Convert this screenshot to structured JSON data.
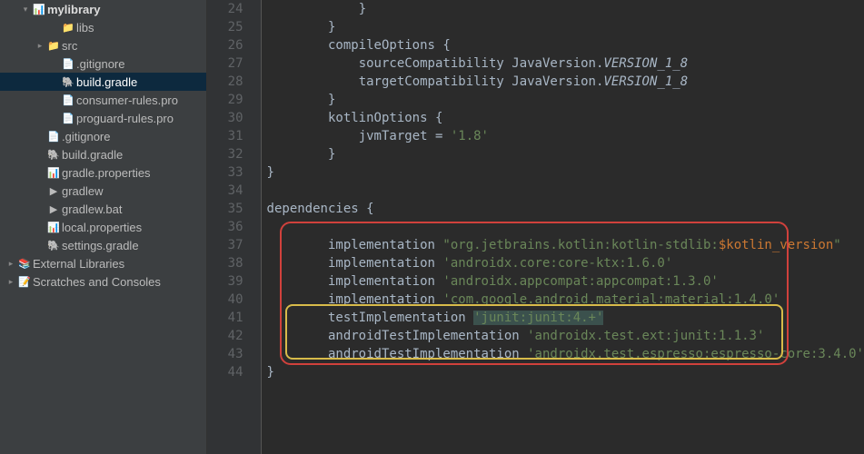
{
  "tree": {
    "root": "mylibrary",
    "items": [
      {
        "label": "libs",
        "kind": "folder"
      },
      {
        "label": "src",
        "kind": "folder-expandable"
      },
      {
        "label": ".gitignore",
        "kind": "file"
      },
      {
        "label": "build.gradle",
        "kind": "gradle",
        "selected": true
      },
      {
        "label": "consumer-rules.pro",
        "kind": "file"
      },
      {
        "label": "proguard-rules.pro",
        "kind": "file"
      }
    ],
    "rootFiles": [
      {
        "label": ".gitignore",
        "kind": "file"
      },
      {
        "label": "build.gradle",
        "kind": "gradle"
      },
      {
        "label": "gradle.properties",
        "kind": "props"
      },
      {
        "label": "gradlew",
        "kind": "script"
      },
      {
        "label": "gradlew.bat",
        "kind": "script"
      },
      {
        "label": "local.properties",
        "kind": "props"
      },
      {
        "label": "settings.gradle",
        "kind": "gradle"
      }
    ],
    "external": "External Libraries",
    "scratches": "Scratches and Consoles"
  },
  "code": {
    "startLine": 24,
    "lines": [
      {
        "n": 24,
        "indent": 3,
        "tokens": [
          [
            "plain",
            "}"
          ]
        ]
      },
      {
        "n": 25,
        "indent": 2,
        "tokens": [
          [
            "plain",
            "}"
          ]
        ]
      },
      {
        "n": 26,
        "indent": 2,
        "tokens": [
          [
            "plain",
            "compileOptions {"
          ]
        ]
      },
      {
        "n": 27,
        "indent": 3,
        "tokens": [
          [
            "plain",
            "sourceCompatibility JavaVersion."
          ],
          [
            "emph",
            "VERSION_1_8"
          ]
        ]
      },
      {
        "n": 28,
        "indent": 3,
        "tokens": [
          [
            "plain",
            "targetCompatibility JavaVersion."
          ],
          [
            "emph",
            "VERSION_1_8"
          ]
        ]
      },
      {
        "n": 29,
        "indent": 2,
        "tokens": [
          [
            "plain",
            "}"
          ]
        ]
      },
      {
        "n": 30,
        "indent": 2,
        "tokens": [
          [
            "plain",
            "kotlinOptions {"
          ]
        ]
      },
      {
        "n": 31,
        "indent": 3,
        "tokens": [
          [
            "plain",
            "jvmTarget = "
          ],
          [
            "str",
            "'1.8'"
          ]
        ]
      },
      {
        "n": 32,
        "indent": 2,
        "tokens": [
          [
            "plain",
            "}"
          ]
        ]
      },
      {
        "n": 33,
        "indent": 0,
        "tokens": [
          [
            "plain",
            "}"
          ]
        ]
      },
      {
        "n": 34,
        "indent": 0,
        "tokens": [
          [
            "plain",
            ""
          ]
        ]
      },
      {
        "n": 35,
        "indent": 0,
        "tokens": [
          [
            "plain",
            "dependencies {"
          ]
        ]
      },
      {
        "n": 36,
        "indent": 0,
        "tokens": [
          [
            "plain",
            ""
          ]
        ]
      },
      {
        "n": 37,
        "indent": 2,
        "tokens": [
          [
            "plain",
            "implementation "
          ],
          [
            "str",
            "\"org.jetbrains.kotlin:kotlin-stdlib:"
          ],
          [
            "varref",
            "$kotlin_version"
          ],
          [
            "str",
            "\""
          ]
        ]
      },
      {
        "n": 38,
        "indent": 2,
        "tokens": [
          [
            "plain",
            "implementation "
          ],
          [
            "str",
            "'androidx.core:core-ktx:1.6.0'"
          ]
        ]
      },
      {
        "n": 39,
        "indent": 2,
        "tokens": [
          [
            "plain",
            "implementation "
          ],
          [
            "str",
            "'androidx.appcompat:appcompat:1.3.0'"
          ]
        ]
      },
      {
        "n": 40,
        "indent": 2,
        "tokens": [
          [
            "plain",
            "implementation "
          ],
          [
            "str",
            "'com.google.android.material:material:1.4.0'"
          ]
        ]
      },
      {
        "n": 41,
        "indent": 2,
        "tokens": [
          [
            "plain",
            "testImplementation "
          ],
          [
            "str str-bg",
            "'junit:junit:4.+'"
          ]
        ]
      },
      {
        "n": 42,
        "indent": 2,
        "tokens": [
          [
            "plain",
            "androidTestImplementation "
          ],
          [
            "str",
            "'androidx.test.ext:junit:1.1.3'"
          ]
        ]
      },
      {
        "n": 43,
        "indent": 2,
        "tokens": [
          [
            "plain",
            "androidTestImplementation "
          ],
          [
            "str",
            "'androidx.test.espresso:espresso-core:3.4.0'"
          ]
        ]
      },
      {
        "n": 44,
        "indent": 0,
        "tokens": [
          [
            "plain",
            "}"
          ]
        ]
      }
    ]
  }
}
